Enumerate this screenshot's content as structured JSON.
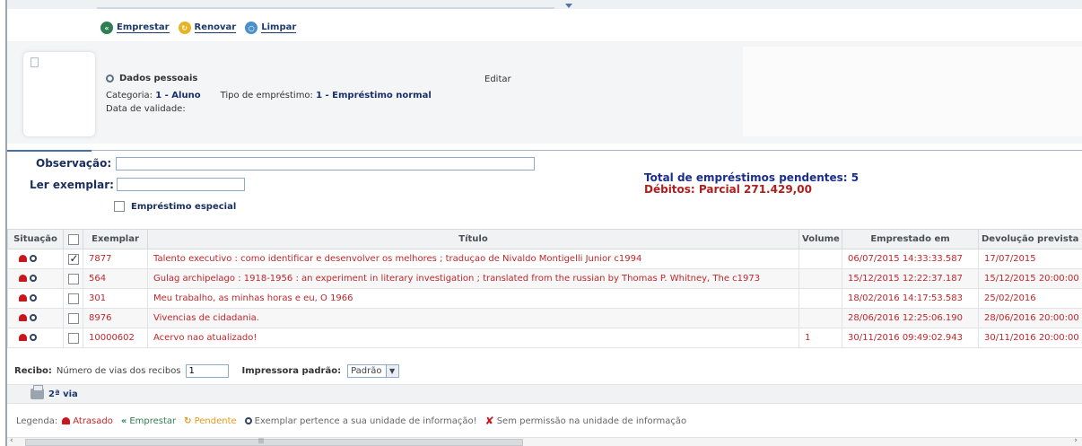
{
  "toolbar": {
    "emprestar": "Emprestar",
    "renovar": "Renovar",
    "limpar": "Limpar"
  },
  "patron": {
    "dados_label": "Dados pessoais",
    "editar": "Editar",
    "categoria_label": "Categoria:",
    "categoria_value": "1 - Aluno",
    "tipo_label": "Tipo de empréstimo:",
    "tipo_value": "1 - Empréstimo normal",
    "validade_label": "Data de validade:"
  },
  "form": {
    "observacao_label": "Observação:",
    "observacao_value": "",
    "ler_label": "Ler exemplar:",
    "ler_value": "",
    "especial_label": "Empréstimo especial",
    "especial_checked": false
  },
  "totals": {
    "pendentes": "Total de empréstimos pendentes: 5",
    "debitos": "Débitos: Parcial 271.429,00"
  },
  "table": {
    "headers": {
      "situacao": "Situação",
      "exemplar": "Exemplar",
      "titulo": "Título",
      "volume": "Volume",
      "emprestado": "Emprestado em",
      "devolucao": "Devolução prevista"
    },
    "rows": [
      {
        "checked": true,
        "exemplar": "7877",
        "titulo": "Talento executivo : como identificar e desenvolver os melhores ; traduçao de Nivaldo Montigelli Junior c1994",
        "volume": "",
        "emprestado": "06/07/2015 14:33:33.587",
        "devolucao": "17/07/2015"
      },
      {
        "checked": false,
        "exemplar": "564",
        "titulo": "Gulag archipelago : 1918-1956 : an experiment in literary investigation ; translated from the russian by Thomas P. Whitney, The c1973",
        "volume": "",
        "emprestado": "15/12/2015 12:22:37.187",
        "devolucao": "15/12/2015 20:00:00"
      },
      {
        "checked": false,
        "exemplar": "301",
        "titulo": "Meu trabalho, as minhas horas e eu, O 1966",
        "volume": "",
        "emprestado": "18/02/2016 14:17:53.583",
        "devolucao": "25/02/2016"
      },
      {
        "checked": false,
        "exemplar": "8976",
        "titulo": "Vivencias de cidadania.",
        "volume": "",
        "emprestado": "28/06/2016 12:25:06.190",
        "devolucao": "28/06/2016 20:00:00"
      },
      {
        "checked": false,
        "exemplar": "10000602",
        "titulo": "Acervo nao atualizado!",
        "volume": "1",
        "emprestado": "30/11/2016 09:49:02.943",
        "devolucao": "30/11/2016 20:00:00"
      }
    ]
  },
  "recibo": {
    "label": "Recibo:",
    "vias_label": "Número de vias dos recibos",
    "vias_value": "1",
    "impressora_label": "Impressora padrão:",
    "impressora_value": "Padrão"
  },
  "via_button": "2ª via",
  "legend": {
    "label": "Legenda:",
    "atrasado": "Atrasado",
    "emprestar": "Emprestar",
    "pendente": "Pendente",
    "pertence": "Exemplar pertence a sua unidade de informação!",
    "sem_permissao": "Sem permissão na unidade de informação"
  },
  "colors": {
    "accent_navy": "#1a2e6b",
    "overdue_red": "#c0262a",
    "emprestar_green": "#2f7d55",
    "pendente_orange": "#e79a1b"
  }
}
